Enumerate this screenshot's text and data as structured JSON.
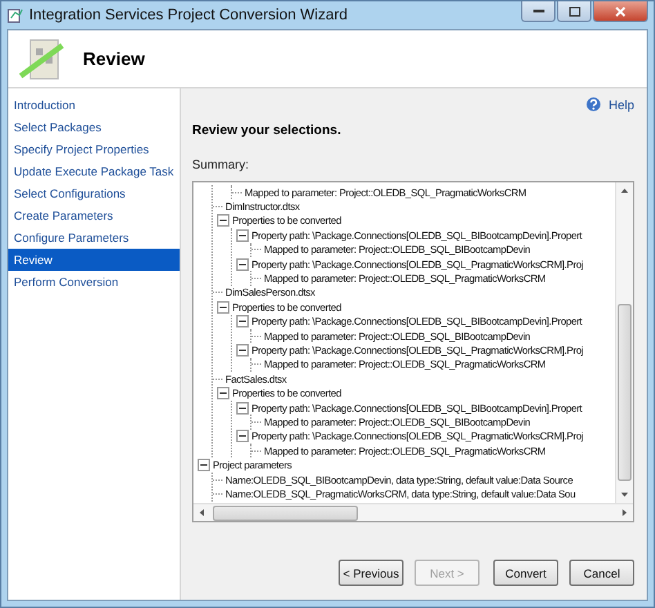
{
  "window": {
    "title": "Integration Services Project Conversion Wizard"
  },
  "header": {
    "title": "Review"
  },
  "nav": [
    {
      "label": "Introduction",
      "selected": false
    },
    {
      "label": "Select Packages",
      "selected": false
    },
    {
      "label": "Specify Project Properties",
      "selected": false
    },
    {
      "label": "Update Execute Package Task",
      "selected": false
    },
    {
      "label": "Select Configurations",
      "selected": false
    },
    {
      "label": "Create Parameters",
      "selected": false
    },
    {
      "label": "Configure Parameters",
      "selected": false
    },
    {
      "label": "Review",
      "selected": true
    },
    {
      "label": "Perform Conversion",
      "selected": false
    }
  ],
  "help": "Help",
  "heading": "Review your selections.",
  "summary_label": "Summary:",
  "tree": [
    {
      "children": [
        {
          "children": [
            {
              "label": "Mapped to parameter:  Project::OLEDB_SQL_PragmaticWorksCRM"
            }
          ]
        },
        {
          "label": "DimInstructor.dtsx"
        },
        {
          "label": "Properties to be converted",
          "expanded": true,
          "children": [
            {
              "label": "Property path: \\Package.Connections[OLEDB_SQL_BIBootcampDevin].Propert",
              "expanded": true,
              "children": [
                {
                  "label": "Mapped to parameter:  Project::OLEDB_SQL_BIBootcampDevin"
                }
              ]
            },
            {
              "label": "Property path: \\Package.Connections[OLEDB_SQL_PragmaticWorksCRM].Proj",
              "expanded": true,
              "children": [
                {
                  "label": "Mapped to parameter:  Project::OLEDB_SQL_PragmaticWorksCRM"
                }
              ]
            }
          ]
        },
        {
          "label": "DimSalesPerson.dtsx"
        },
        {
          "label": "Properties to be converted",
          "expanded": true,
          "children": [
            {
              "label": "Property path: \\Package.Connections[OLEDB_SQL_BIBootcampDevin].Propert",
              "expanded": true,
              "children": [
                {
                  "label": "Mapped to parameter:  Project::OLEDB_SQL_BIBootcampDevin"
                }
              ]
            },
            {
              "label": "Property path: \\Package.Connections[OLEDB_SQL_PragmaticWorksCRM].Proj",
              "expanded": true,
              "children": [
                {
                  "label": "Mapped to parameter:  Project::OLEDB_SQL_PragmaticWorksCRM"
                }
              ]
            }
          ]
        },
        {
          "label": "FactSales.dtsx"
        },
        {
          "label": "Properties to be converted",
          "expanded": true,
          "children": [
            {
              "label": "Property path: \\Package.Connections[OLEDB_SQL_BIBootcampDevin].Propert",
              "expanded": true,
              "children": [
                {
                  "label": "Mapped to parameter:  Project::OLEDB_SQL_BIBootcampDevin"
                }
              ]
            },
            {
              "label": "Property path: \\Package.Connections[OLEDB_SQL_PragmaticWorksCRM].Proj",
              "expanded": true,
              "children": [
                {
                  "label": "Mapped to parameter:  Project::OLEDB_SQL_PragmaticWorksCRM"
                }
              ]
            }
          ]
        }
      ]
    },
    {
      "label": "Project parameters",
      "expanded": true,
      "children": [
        {
          "label": "Name:OLEDB_SQL_BIBootcampDevin, data type:String, default value:Data Source"
        },
        {
          "label": "Name:OLEDB_SQL_PragmaticWorksCRM, data type:String, default value:Data Sou"
        }
      ]
    }
  ],
  "buttons": [
    {
      "label": "< Previous",
      "disabled": false
    },
    {
      "label": "Next >",
      "disabled": true
    },
    {
      "label": "Convert",
      "disabled": false
    },
    {
      "label": "Cancel",
      "disabled": false
    }
  ]
}
